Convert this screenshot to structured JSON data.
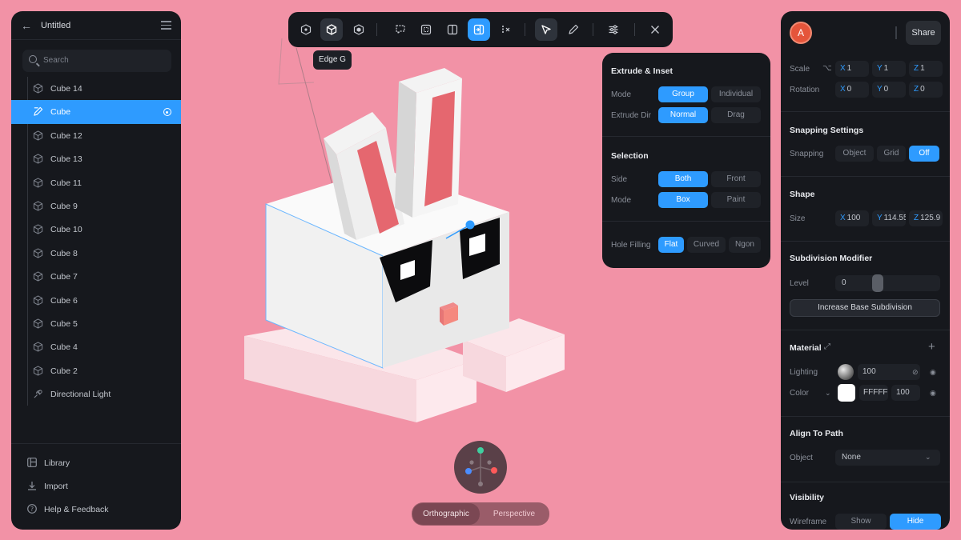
{
  "left_panel": {
    "title": "Untitled",
    "search_placeholder": "Search",
    "objects": [
      {
        "label": "Cube 14",
        "icon": "cube-icon",
        "selected": false
      },
      {
        "label": "Cube",
        "icon": "edit-shape-icon",
        "selected": true
      },
      {
        "label": "Cube 12",
        "icon": "cube-icon",
        "selected": false
      },
      {
        "label": "Cube 13",
        "icon": "cube-icon",
        "selected": false
      },
      {
        "label": "Cube 11",
        "icon": "cube-icon",
        "selected": false
      },
      {
        "label": "Cube 9",
        "icon": "cube-icon",
        "selected": false
      },
      {
        "label": "Cube 10",
        "icon": "cube-icon",
        "selected": false
      },
      {
        "label": "Cube 8",
        "icon": "cube-icon",
        "selected": false
      },
      {
        "label": "Cube 7",
        "icon": "cube-icon",
        "selected": false
      },
      {
        "label": "Cube 6",
        "icon": "cube-icon",
        "selected": false
      },
      {
        "label": "Cube 5",
        "icon": "cube-icon",
        "selected": false
      },
      {
        "label": "Cube 4",
        "icon": "cube-icon",
        "selected": false
      },
      {
        "label": "Cube 2",
        "icon": "cube-icon",
        "selected": false
      },
      {
        "label": "Directional Light",
        "icon": "light-icon",
        "selected": false
      }
    ],
    "footer": {
      "library": "Library",
      "import": "Import",
      "help": "Help & Feedback"
    }
  },
  "toolbar": {
    "tooltip": "Edge G",
    "tools": [
      "vertex-mode-icon",
      "edge-mode-icon",
      "face-mode-icon",
      "lasso-select-icon",
      "box-select-icon",
      "split-icon",
      "extrude-icon",
      "remove-icon",
      "pointer-icon",
      "pen-icon",
      "sliders-icon",
      "close-icon"
    ]
  },
  "popover": {
    "extrude_title": "Extrude & Inset",
    "mode_label": "Mode",
    "mode_options": [
      "Group",
      "Individual"
    ],
    "extrude_dir_label": "Extrude Dir",
    "extrude_dir_options": [
      "Normal",
      "Drag"
    ],
    "selection_title": "Selection",
    "side_label": "Side",
    "side_options": [
      "Both",
      "Front"
    ],
    "sel_mode_label": "Mode",
    "sel_mode_options": [
      "Box",
      "Paint"
    ],
    "hole_label": "Hole Filling",
    "hole_options": [
      "Flat",
      "Curved",
      "Ngon"
    ]
  },
  "right_panel": {
    "avatar_letter": "A",
    "share_label": "Share",
    "scale": {
      "label": "Scale",
      "x": "1",
      "y": "1",
      "z": "1"
    },
    "rotation": {
      "label": "Rotation",
      "x": "0",
      "y": "0",
      "z": "0"
    },
    "axes": {
      "x": "X",
      "y": "Y",
      "z": "Z"
    },
    "snapping": {
      "title": "Snapping Settings",
      "label": "Snapping",
      "options": [
        "Object",
        "Grid",
        "Off"
      ]
    },
    "shape": {
      "title": "Shape",
      "label": "Size",
      "x": "100",
      "y": "114.55",
      "z": "125.9"
    },
    "subdivision": {
      "title": "Subdivision Modifier",
      "level_label": "Level",
      "level_value": "0",
      "button": "Increase Base Subdivision"
    },
    "material": {
      "title": "Material",
      "lighting_label": "Lighting",
      "lighting_value": "100",
      "color_label": "Color",
      "color_hex": "FFFFFF",
      "color_opacity": "100"
    },
    "align": {
      "title": "Align To Path",
      "object_label": "Object",
      "object_value": "None"
    },
    "visibility": {
      "title": "Visibility",
      "wireframe_label": "Wireframe",
      "options": [
        "Show",
        "Hide"
      ]
    }
  },
  "view": {
    "orthographic": "Orthographic",
    "perspective": "Perspective"
  },
  "colors": {
    "background": "#f292a6",
    "accent": "#2e9bff",
    "panel": "#16181d"
  }
}
